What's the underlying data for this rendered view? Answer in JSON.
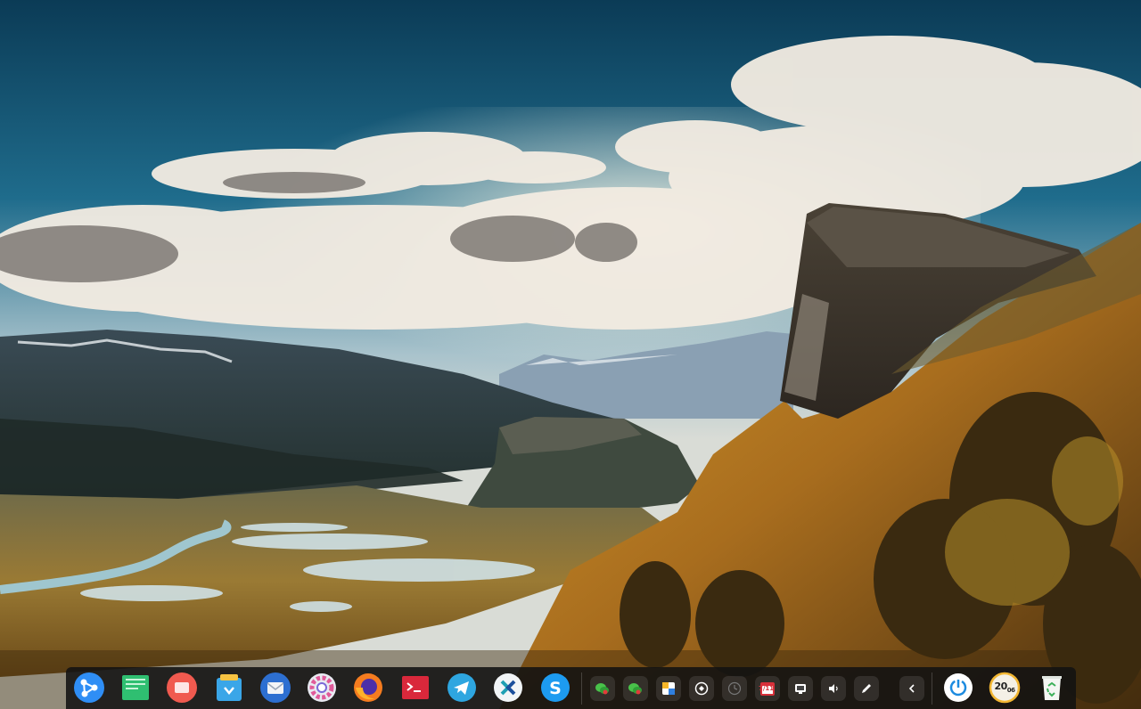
{
  "desktop": {
    "wallpaper": "mountain-valley-landscape"
  },
  "dock": {
    "apps": [
      {
        "name": "launcher",
        "icon": "launcher-icon",
        "color": "#2f8ef5"
      },
      {
        "name": "file-manager",
        "icon": "folder-icon",
        "color": "#2fbf71"
      },
      {
        "name": "screen-recorder",
        "icon": "screen-recorder-icon",
        "color": "#f05a4f"
      },
      {
        "name": "app-store",
        "icon": "store-icon",
        "color": "#3aa6e8"
      },
      {
        "name": "mail",
        "icon": "mail-icon",
        "color": "#2d6fd1"
      },
      {
        "name": "settings",
        "icon": "gear-icon",
        "color": "#e8eaf1"
      },
      {
        "name": "firefox",
        "icon": "firefox-icon",
        "color": "#f57c1f"
      },
      {
        "name": "terminal",
        "icon": "terminal-icon",
        "color": "#d9283b"
      },
      {
        "name": "telegram",
        "icon": "telegram-icon",
        "color": "#2ea6e0"
      },
      {
        "name": "remote-desktop",
        "icon": "remote-desktop-icon",
        "color": "#1fa0b4"
      },
      {
        "name": "skype",
        "icon": "skype-icon",
        "color": "#1d9bf0"
      }
    ],
    "tray": [
      {
        "name": "wechat",
        "icon": "wechat-icon"
      },
      {
        "name": "wechat-2",
        "icon": "wechat-icon"
      },
      {
        "name": "window-switch",
        "icon": "window-icon"
      },
      {
        "name": "clipboard",
        "icon": "target-icon"
      },
      {
        "name": "timer",
        "icon": "clock-icon"
      },
      {
        "name": "calendar",
        "icon": "calendar-icon",
        "value": "7/11"
      },
      {
        "name": "notification",
        "icon": "message-icon"
      },
      {
        "name": "volume",
        "icon": "volume-icon"
      },
      {
        "name": "picker",
        "icon": "pen-icon"
      },
      {
        "name": "collapse",
        "icon": "chevron-left-icon"
      }
    ],
    "power": {
      "icon": "power-icon"
    },
    "clock": {
      "hour": "20",
      "minute": "06"
    },
    "trash": {
      "icon": "trash-icon"
    }
  }
}
